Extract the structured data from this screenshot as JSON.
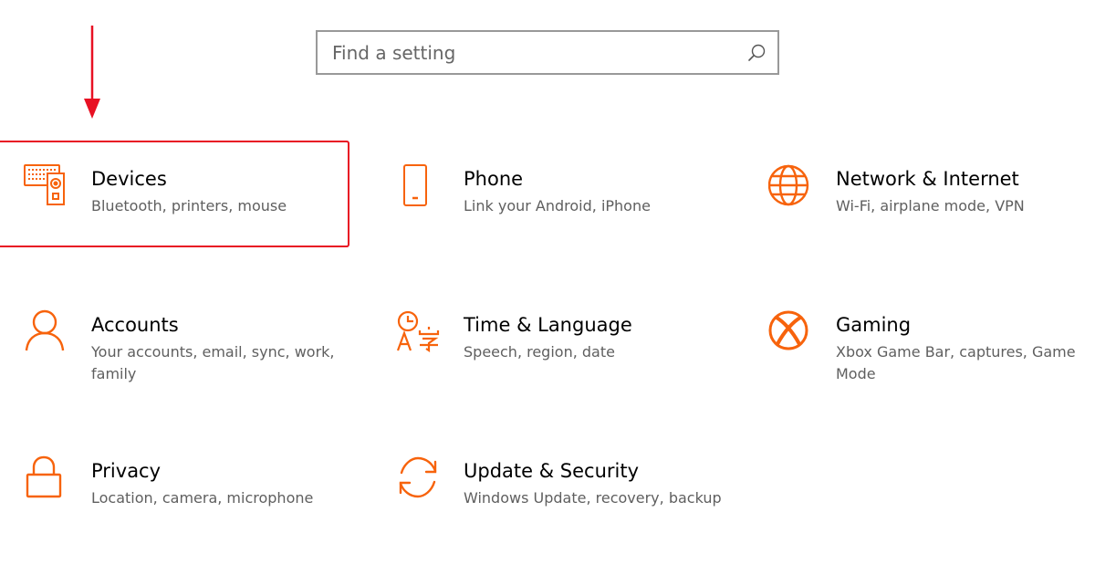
{
  "search": {
    "placeholder": "Find a setting",
    "value": ""
  },
  "colors": {
    "accent": "#f7630c",
    "annotation": "#e81123"
  },
  "tiles": [
    {
      "title": "Devices",
      "description": "Bluetooth, printers, mouse",
      "icon": "devices-icon"
    },
    {
      "title": "Phone",
      "description": "Link your Android, iPhone",
      "icon": "phone-icon"
    },
    {
      "title": "Network & Internet",
      "description": "Wi-Fi, airplane mode, VPN",
      "icon": "globe-icon"
    },
    {
      "title": "Accounts",
      "description": "Your accounts, email, sync, work, family",
      "icon": "person-icon"
    },
    {
      "title": "Time & Language",
      "description": "Speech, region, date",
      "icon": "time-language-icon"
    },
    {
      "title": "Gaming",
      "description": "Xbox Game Bar, captures, Game Mode",
      "icon": "xbox-icon"
    },
    {
      "title": "Privacy",
      "description": "Location, camera, microphone",
      "icon": "lock-icon"
    },
    {
      "title": "Update & Security",
      "description": "Windows Update, recovery, backup",
      "icon": "sync-icon"
    }
  ]
}
